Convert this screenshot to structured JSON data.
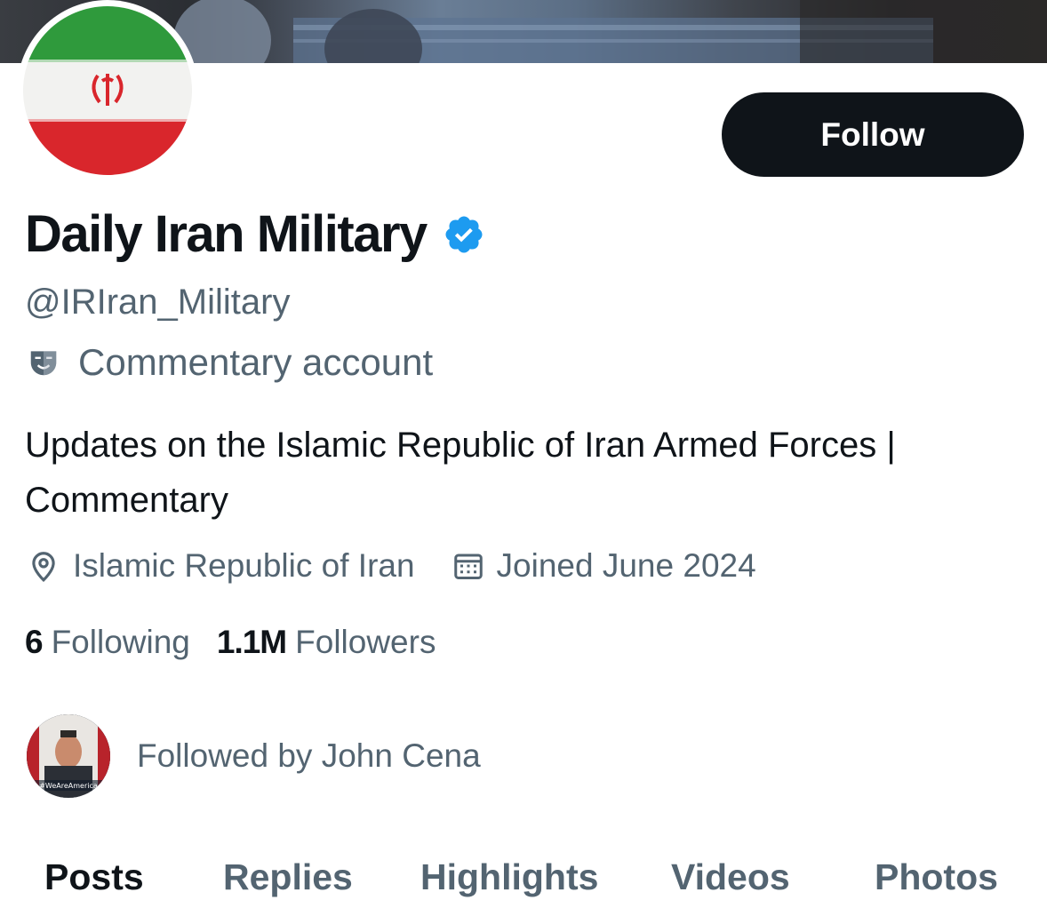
{
  "profile": {
    "follow_label": "Follow",
    "display_name": "Daily Iran Military",
    "handle": "@IRIran_Military",
    "account_label": "Commentary account",
    "bio": "Updates on the Islamic Republic of Iran Armed Forces | Commentary",
    "location": "Islamic Republic of Iran",
    "joined": "Joined June 2024",
    "following_count": "6",
    "following_label": "Following",
    "followers_count": "1.1M",
    "followers_label": "Followers",
    "followed_by": "Followed by John Cena",
    "mini_avatar_caption": "#WeAreAmerica"
  },
  "tabs": [
    {
      "label": "Posts",
      "active": true
    },
    {
      "label": "Replies",
      "active": false
    },
    {
      "label": "Highlights",
      "active": false
    },
    {
      "label": "Videos",
      "active": false
    },
    {
      "label": "Photos",
      "active": false
    }
  ],
  "colors": {
    "text_primary": "#0f1419",
    "text_secondary": "#536471",
    "verified_blue": "#1d9bf0",
    "button_bg": "#0f1419"
  },
  "icons": [
    "verified-badge-icon",
    "theater-mask-icon",
    "location-pin-icon",
    "calendar-icon"
  ]
}
